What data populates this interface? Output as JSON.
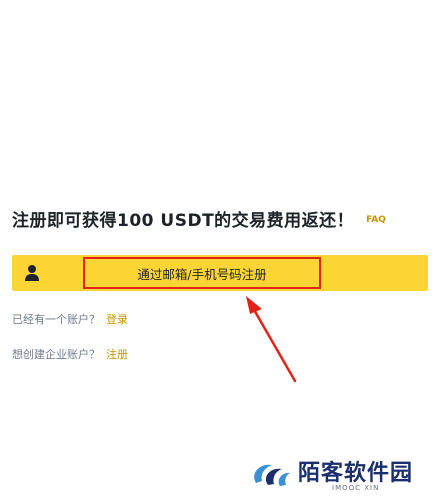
{
  "headline": {
    "text": "注册即可获得100 USDT的交易费用返还！",
    "faq_label": "FAQ"
  },
  "signup": {
    "icon": "user-icon",
    "button_label": "通过邮箱/手机号码注册",
    "highlight_color": "#e2231a",
    "bar_color": "#fcd535"
  },
  "login_prompt": {
    "text": "已经有一个账户？",
    "link": "登录"
  },
  "enterprise_prompt": {
    "text": "想创建企业账户？",
    "link": "注册"
  },
  "annotation": {
    "arrow_color": "#e2231a"
  },
  "watermark": {
    "title": "陌客软件园",
    "subtitle": "IMOOC XIN"
  }
}
